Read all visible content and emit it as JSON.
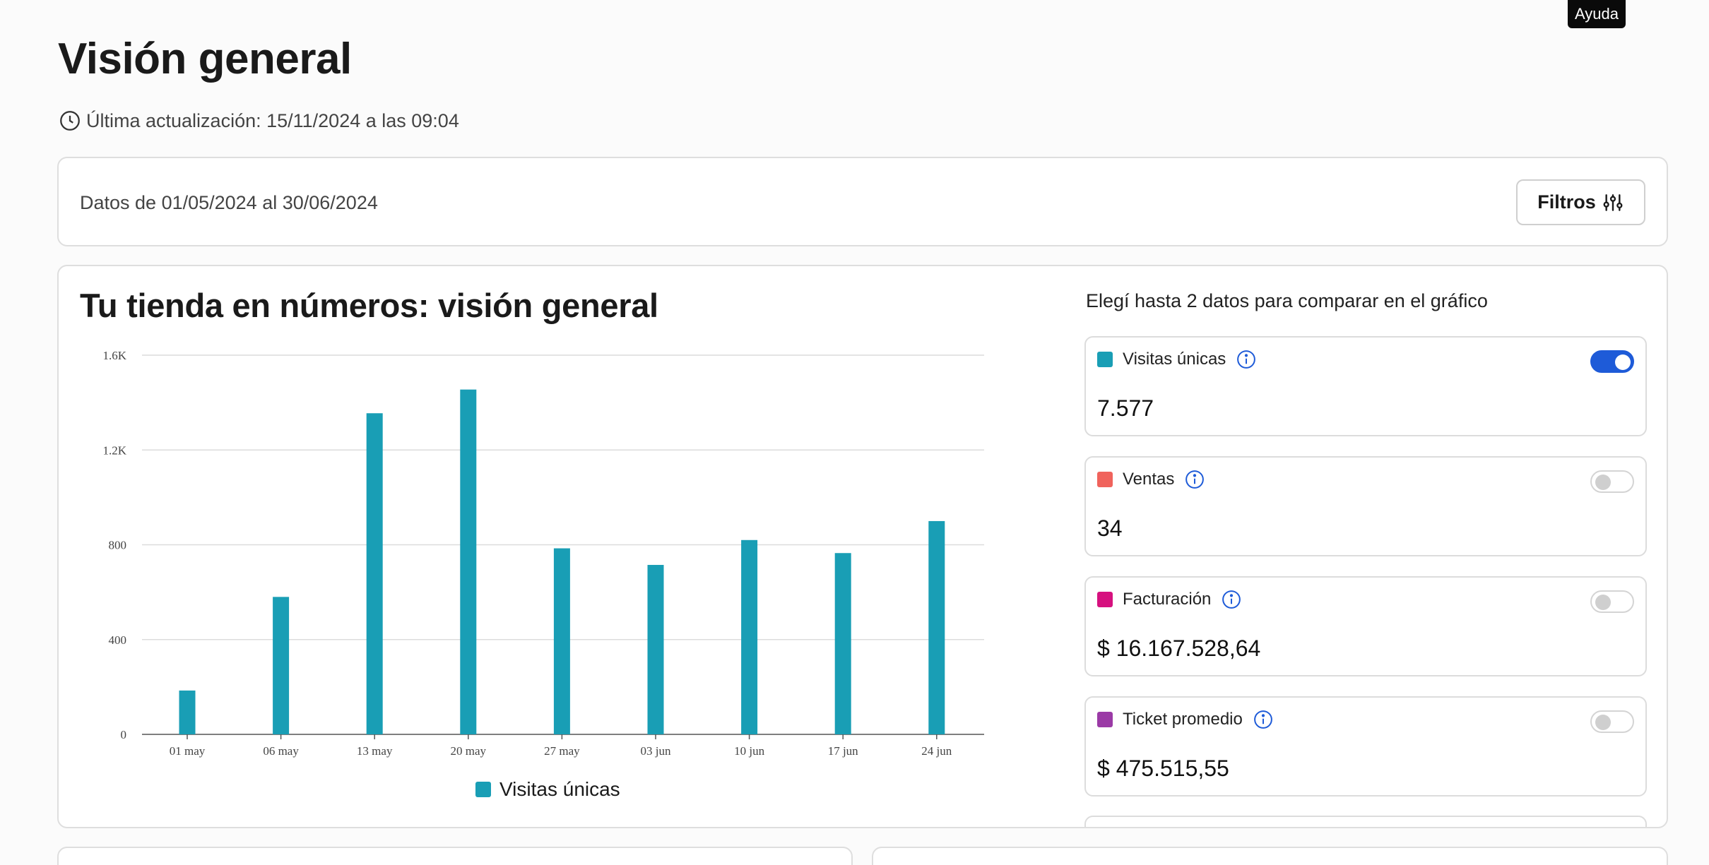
{
  "help": {
    "label": "Ayuda"
  },
  "header": {
    "title": "Visión general",
    "last_updated": "Última actualización: 15/11/2024 a las 09:04"
  },
  "filters": {
    "range": "Datos de 01/05/2024 al 30/06/2024",
    "button_label": "Filtros"
  },
  "overview": {
    "title": "Tu tienda en números: visión general",
    "compare_hint": "Elegí hasta 2 datos para comparar en el gráfico",
    "metrics": [
      {
        "label": "Visitas únicas",
        "value": "7.577",
        "color": "#199eb5",
        "enabled": true
      },
      {
        "label": "Ventas",
        "value": "34",
        "color": "#f0635c",
        "enabled": false
      },
      {
        "label": "Facturación",
        "value": "$ 16.167.528,64",
        "color": "#d6117f",
        "enabled": false
      },
      {
        "label": "Ticket promedio",
        "value": "$ 475.515,55",
        "color": "#9b3aa6",
        "enabled": false
      }
    ]
  },
  "chart_data": {
    "type": "bar",
    "categories": [
      "01 may",
      "06 may",
      "13 may",
      "20 may",
      "27 may",
      "03 jun",
      "10 jun",
      "17 jun",
      "24 jun"
    ],
    "series": [
      {
        "name": "Visitas únicas",
        "color": "#199eb5",
        "values": [
          185,
          580,
          1355,
          1455,
          785,
          715,
          820,
          765,
          900
        ]
      }
    ],
    "ylim": [
      0,
      1600
    ],
    "yticks": [
      0,
      400,
      800,
      1200,
      1600
    ],
    "ytick_labels": [
      "0",
      "400",
      "800",
      "1.2K",
      "1.6K"
    ],
    "grid": true,
    "legend": "bottom"
  },
  "colors": {
    "accent": "#1e5bd8",
    "info": "#1e5bd8"
  }
}
